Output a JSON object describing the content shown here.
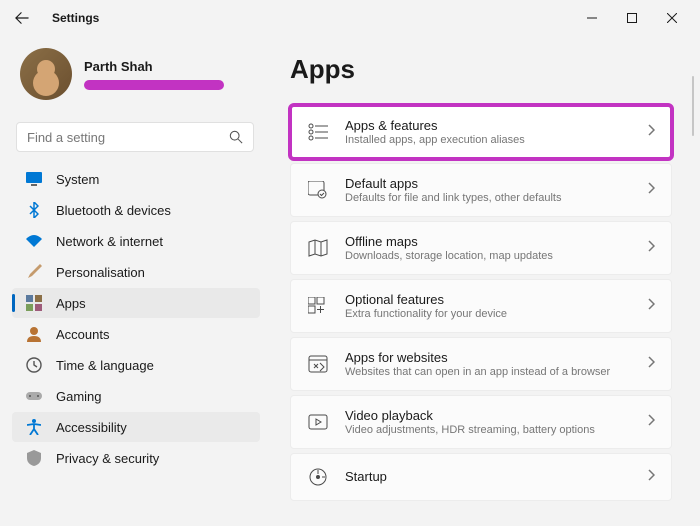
{
  "window": {
    "title": "Settings"
  },
  "profile": {
    "name": "Parth Shah"
  },
  "search": {
    "placeholder": "Find a setting"
  },
  "sidebar": {
    "items": [
      {
        "label": "System",
        "icon": "system-icon"
      },
      {
        "label": "Bluetooth & devices",
        "icon": "bluetooth-icon"
      },
      {
        "label": "Network & internet",
        "icon": "wifi-icon"
      },
      {
        "label": "Personalisation",
        "icon": "brush-icon"
      },
      {
        "label": "Apps",
        "icon": "apps-icon",
        "selected": true
      },
      {
        "label": "Accounts",
        "icon": "accounts-icon"
      },
      {
        "label": "Time & language",
        "icon": "time-icon"
      },
      {
        "label": "Gaming",
        "icon": "gaming-icon"
      },
      {
        "label": "Accessibility",
        "icon": "accessibility-icon",
        "hover": true
      },
      {
        "label": "Privacy & security",
        "icon": "privacy-icon"
      }
    ]
  },
  "page": {
    "title": "Apps",
    "cards": [
      {
        "title": "Apps & features",
        "sub": "Installed apps, app execution aliases",
        "icon": "apps-features-icon",
        "highlight": true
      },
      {
        "title": "Default apps",
        "sub": "Defaults for file and link types, other defaults",
        "icon": "default-apps-icon"
      },
      {
        "title": "Offline maps",
        "sub": "Downloads, storage location, map updates",
        "icon": "maps-icon"
      },
      {
        "title": "Optional features",
        "sub": "Extra functionality for your device",
        "icon": "optional-features-icon"
      },
      {
        "title": "Apps for websites",
        "sub": "Websites that can open in an app instead of a browser",
        "icon": "apps-websites-icon"
      },
      {
        "title": "Video playback",
        "sub": "Video adjustments, HDR streaming, battery options",
        "icon": "video-icon"
      },
      {
        "title": "Startup",
        "sub": "",
        "icon": "startup-icon"
      }
    ]
  }
}
